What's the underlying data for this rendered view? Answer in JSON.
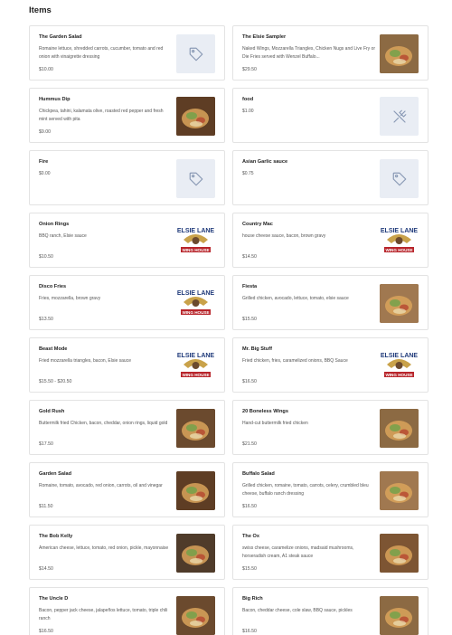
{
  "page": {
    "title": "Items"
  },
  "items": [
    {
      "name": "The Garden Salad",
      "desc": "Romaine lettuce, shredded carrots, cucumber, tomato and red onion with vinaigrette dressing",
      "price": "$10.00",
      "image": "tag-icon"
    },
    {
      "name": "The Elsie Sampler",
      "desc": "Naked Wings, Mozzarella Triangles, Chicken Nugs and Live Fry or Die Fries served with Wenzel Buffalo...",
      "price": "$29.50",
      "image": "photo"
    },
    {
      "name": "Hummus Dip",
      "desc": "Chickpea, tahini, kalamata olive, roasted red pepper and fresh mint served with pita",
      "price": "$9.00",
      "image": "photo"
    },
    {
      "name": "food",
      "desc": "$1.00",
      "price": "",
      "image": "utensils-icon"
    },
    {
      "name": "Fire",
      "desc": "$0.00",
      "price": "",
      "image": "tag-icon"
    },
    {
      "name": "Asian Garlic sauce",
      "desc": "$0.75",
      "price": "",
      "image": "tag-icon"
    },
    {
      "name": "Onion Rings",
      "desc": "BBQ ranch, Elsie sauce",
      "price": "$10.50",
      "image": "logo"
    },
    {
      "name": "Country Mac",
      "desc": "house cheese sauce, bacon, brown gravy",
      "price": "$14.50",
      "image": "logo"
    },
    {
      "name": "Disco Fries",
      "desc": "Fries, mozzarella, brown gravy",
      "price": "$13.50",
      "image": "logo"
    },
    {
      "name": "Fiesta",
      "desc": "Grilled chicken, avocado, lettuce, tomato, elsie sauce",
      "price": "$15.50",
      "image": "photo"
    },
    {
      "name": "Beast Mode",
      "desc": "Fried mozzarella triangles, bacon, Elsie sauce",
      "price": "$15.50 - $20.50",
      "image": "logo"
    },
    {
      "name": "Mr. Big Stuff",
      "desc": "Fried chicken, fries, caramelized onions, BBQ Sauce",
      "price": "$16.50",
      "image": "logo"
    },
    {
      "name": "Gold Rush",
      "desc": "Buttermilk fried Chicken, bacon, cheddar, onion rings, liquid gold",
      "price": "$17.50",
      "image": "photo"
    },
    {
      "name": "20 Boneless Wings",
      "desc": "Hand-cut buttermilk fried chicken",
      "price": "$21.50",
      "image": "photo"
    },
    {
      "name": "Garden Salad",
      "desc": "Romaine, tomato, avocado, red onion, carrots, oil and vinegar",
      "price": "$11.50",
      "image": "photo"
    },
    {
      "name": "Buffalo Salad",
      "desc": "Grilled chicken, romaine, tomato, carrots, celery, crumbled bleu cheese, buffalo ranch dressing",
      "price": "$16.50",
      "image": "photo"
    },
    {
      "name": "The Bob Kelly",
      "desc": "American cheese, lettuce, tomato, red onion, pickle, mayonnaise",
      "price": "$14.50",
      "image": "photo"
    },
    {
      "name": "The Ox",
      "desc": "swiss cheese, caramelize onions, madsaid mushrooms, horseradish cream, A1 steak sauce",
      "price": "$15.50",
      "image": "photo"
    },
    {
      "name": "The Uncle D",
      "desc": "Bacon, pepper jack cheese, jalapeños lettuce, tomato, triple chili ranch",
      "price": "$16.50",
      "image": "photo"
    },
    {
      "name": "Big Rich",
      "desc": "Bacon, cheddar cheese, cole slaw, BBQ sauce, pickles",
      "price": "$16.50",
      "image": "photo"
    }
  ],
  "logo": {
    "line1": "ELSIE LANE",
    "line2": "WING HOUSE"
  },
  "colors": {
    "placeholder_bg": "#e9edf4",
    "icon": "#8a9ab5",
    "logo_text": "#1f3a7a",
    "logo_ribbon": "#b8252b"
  }
}
